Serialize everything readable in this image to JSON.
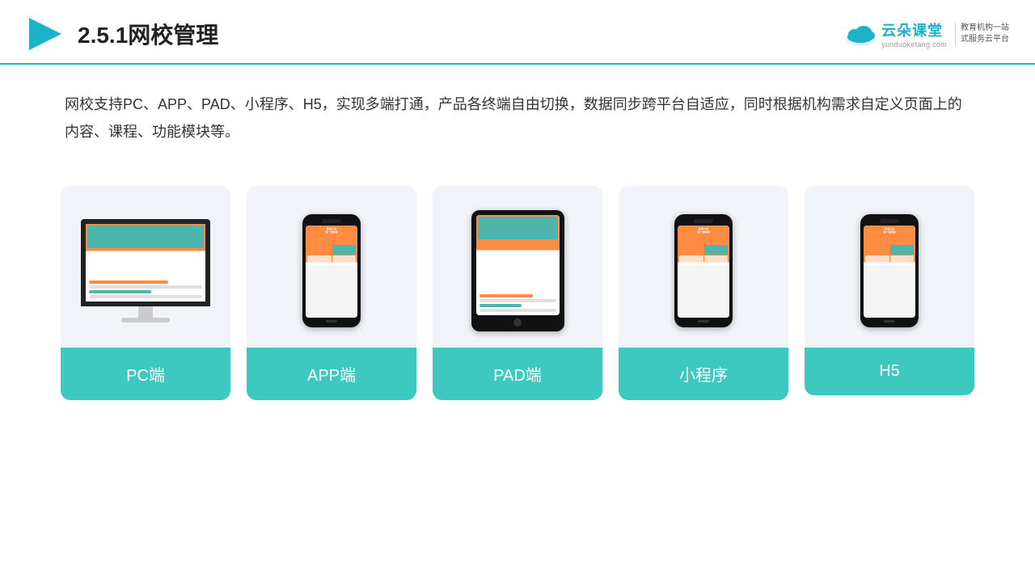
{
  "header": {
    "title": "2.5.1网校管理",
    "logo": {
      "name": "云朵课堂",
      "url": "yunduoketang.com",
      "tagline": "教育机构一站式服务云平台"
    }
  },
  "description": {
    "text": "网校支持PC、APP、PAD、小程序、H5，实现多端打通，产品各终端自由切换，数据同步跨平台自适应，同时根据机构需求自定义页面上的内容、课程、功能模块等。"
  },
  "cards": [
    {
      "id": "pc",
      "label": "PC端"
    },
    {
      "id": "app",
      "label": "APP端"
    },
    {
      "id": "pad",
      "label": "PAD端"
    },
    {
      "id": "miniapp",
      "label": "小程序"
    },
    {
      "id": "h5",
      "label": "H5"
    }
  ],
  "colors": {
    "accent": "#1ab3c8",
    "teal": "#3dc8c0",
    "border": "#1ab3c8"
  }
}
